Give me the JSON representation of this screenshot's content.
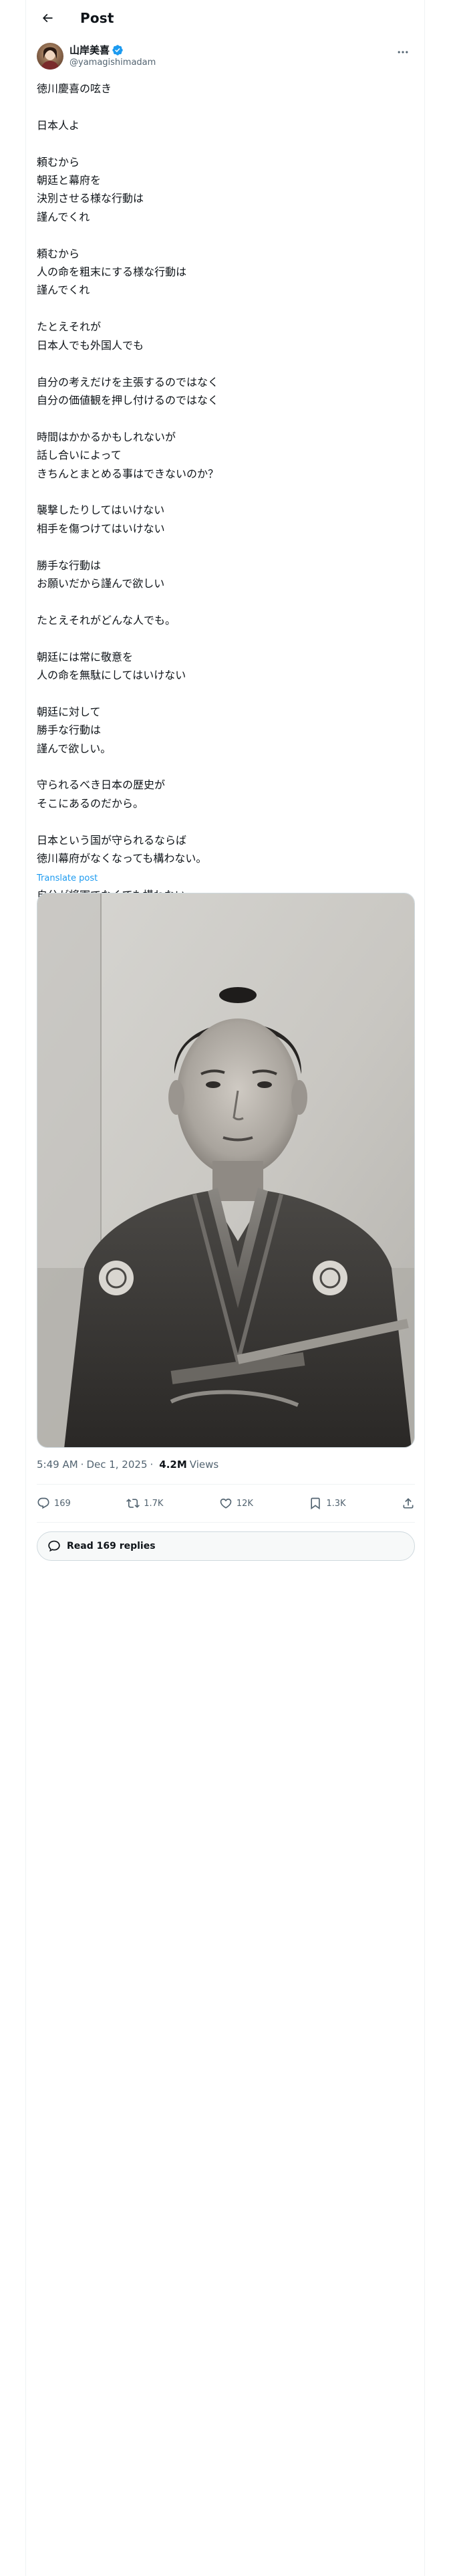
{
  "header": {
    "title": "Post",
    "back_icon": "arrow-left-icon"
  },
  "author": {
    "name": "山岸美喜",
    "handle": "@yamagishimadam",
    "verified": true,
    "verified_color": "#1d9bf0"
  },
  "post": {
    "text": "徳川慶喜の呟き\n\n日本人よ\n\n頼むから\n朝廷と幕府を\n決別させる様な行動は\n謹んでくれ\n\n頼むから\n人の命を粗末にする様な行動は\n謹んでくれ\n\nたとえそれが\n日本人でも外国人でも\n\n自分の考えだけを主張するのではなく\n自分の価値観を押し付けるのではなく\n\n時間はかかるかもしれないが\n話し合いによって\nきちんとまとめる事はできないのか？\n\n襲撃したりしてはいけない\n相手を傷つけてはいけない\n\n勝手な行動は\nお願いだから謹んで欲しい\n\nたとえそれがどんな人でも。\n\n朝廷には常に敬意を\n人の命を無駄にしてはいけない\n\n朝廷に対して\n勝手な行動は\n謹んで欲しい。\n\n守られるべき日本の歴史が\nそこにあるのだから。\n\n日本という国が守られるならば\n徳川幕府がなくなっても構わない。\n\n自分が将軍でなくても構わない。\n\n私はその責任を一才負う覚悟です。",
    "translate_label": "Translate post",
    "accent_color": "#1d9bf0"
  },
  "meta": {
    "time": "5:49 AM",
    "date": "Dec 1, 2025",
    "separator": "·",
    "views_count": "4.2M",
    "views_label": "Views"
  },
  "actions": {
    "replies": {
      "count": "169",
      "icon": "reply-icon"
    },
    "reposts": {
      "count": "1.7K",
      "icon": "repost-icon"
    },
    "likes": {
      "count": "12K",
      "icon": "heart-icon"
    },
    "bookmarks": {
      "count": "1.3K",
      "icon": "bookmark-icon"
    },
    "share": {
      "icon": "share-icon"
    }
  },
  "read_replies": {
    "label": "Read 169 replies",
    "icon": "chat-bubble-icon"
  },
  "colors": {
    "text_primary": "#0f1419",
    "text_secondary": "#536471",
    "border": "#eff3f4"
  }
}
